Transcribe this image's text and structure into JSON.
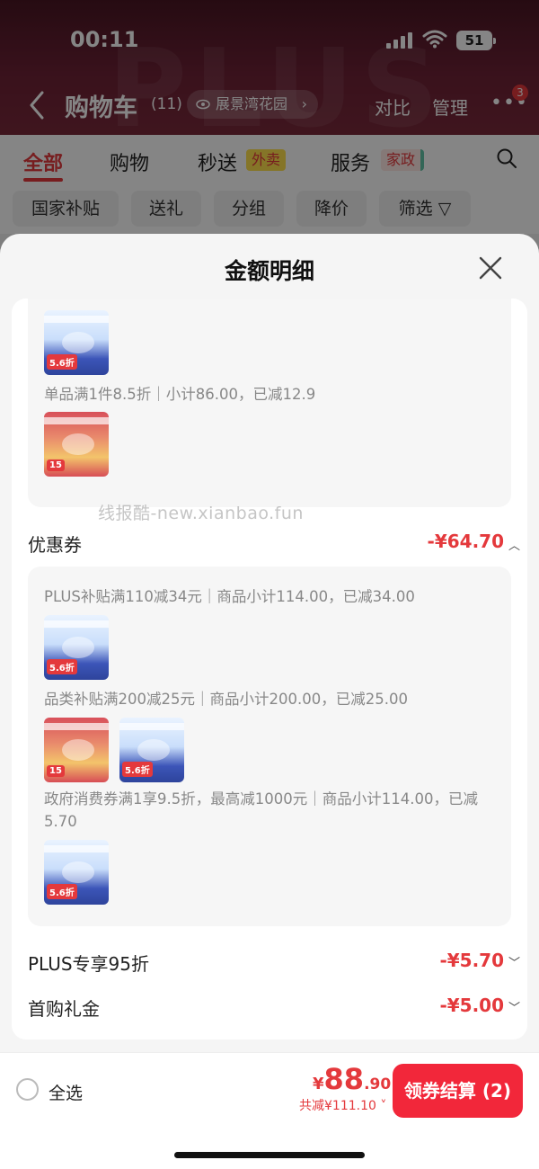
{
  "status_bar": {
    "time": "00:11",
    "battery": "51"
  },
  "header": {
    "title": "购物车",
    "count": "(11)",
    "address": "展景湾花园",
    "compare": "对比",
    "manage": "管理",
    "more_badge": "3"
  },
  "tabs": [
    {
      "label": "全部",
      "active": true
    },
    {
      "label": "购物"
    },
    {
      "label": "秒送",
      "tag": "外卖"
    },
    {
      "label": "服务",
      "tag": "家政"
    }
  ],
  "filters": [
    "国家补贴",
    "送礼",
    "分组",
    "降价",
    "筛选"
  ],
  "sheet": {
    "title": "金额明细",
    "card1": {
      "lines": [
        "单品满1件8.5折｜小计86.00，已减12.9"
      ]
    },
    "coupon": {
      "label": "优惠券",
      "value": "-¥64.70"
    },
    "card2": {
      "lines": [
        "PLUS补贴满110减34元｜商品小计114.00，已减34.00",
        "品类补贴满200减25元｜商品小计200.00，已减25.00",
        "政府消费券满1享9.5折，最高减1000元｜商品小计114.00，已减5.70"
      ]
    },
    "plus": {
      "label": "PLUS专享95折",
      "value": "-¥5.70"
    },
    "first": {
      "label": "首购礼金",
      "value": "-¥5.00"
    },
    "watermark": "线报酷-new.xianbao.fun"
  },
  "footer": {
    "select_all": "全选",
    "price_yen": "¥",
    "price_int": "88",
    "price_dec": ".90",
    "saved": "共减¥111.10",
    "checkout": "领券结算 (2)"
  },
  "colors": {
    "accent": "#e4393c",
    "checkout": "#f2273a"
  }
}
